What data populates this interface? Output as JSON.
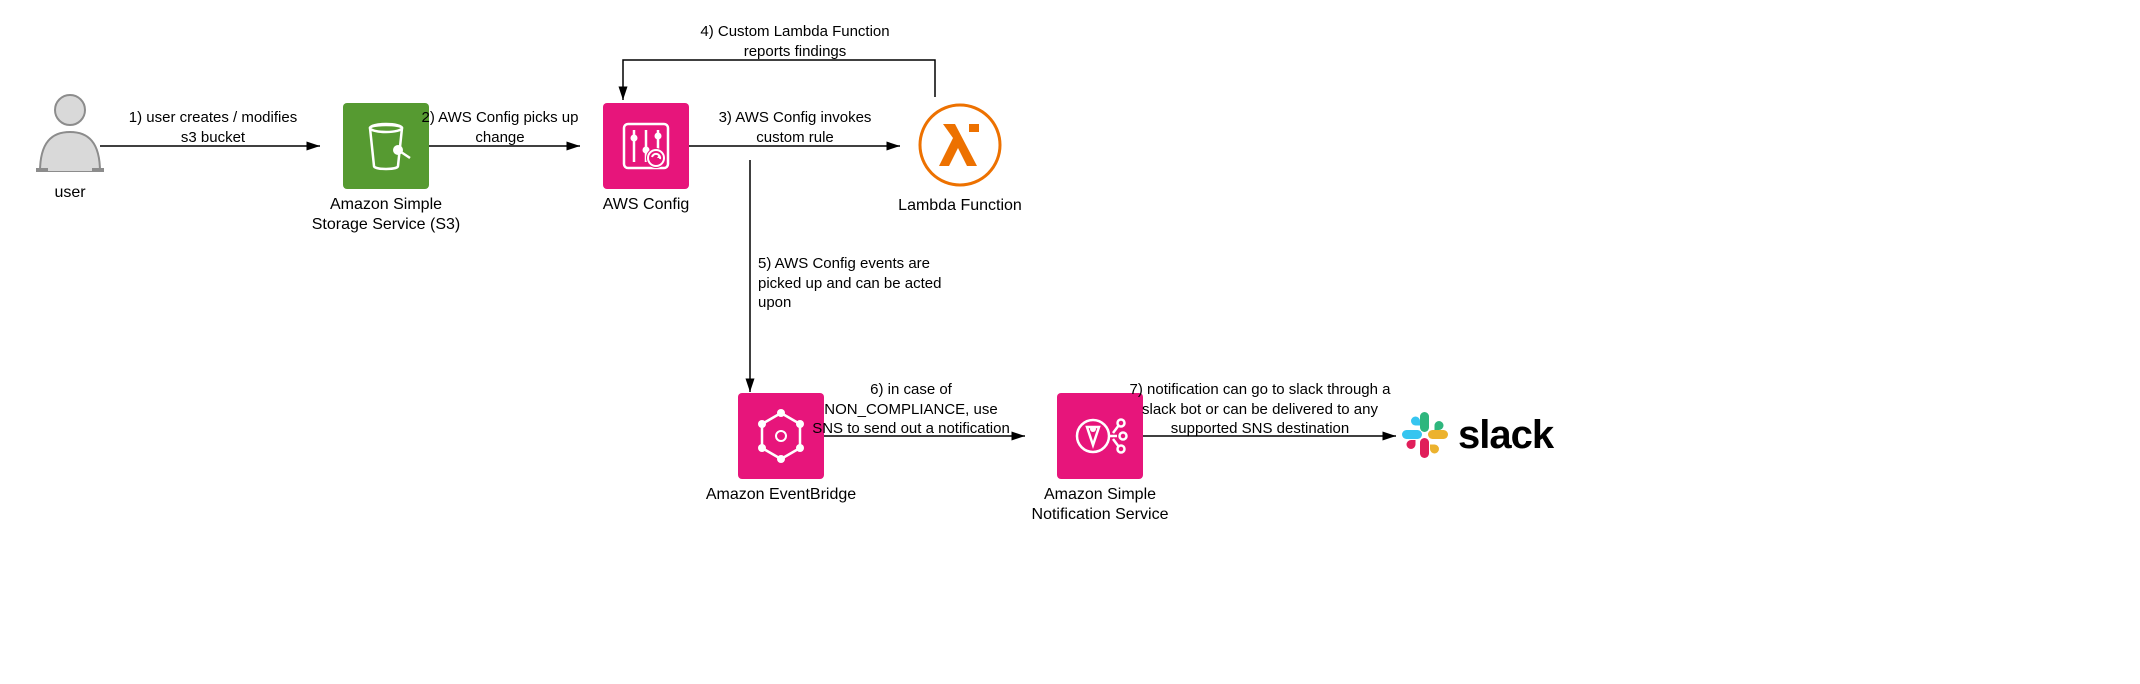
{
  "nodes": {
    "user": {
      "label": "user"
    },
    "s3": {
      "label": "Amazon Simple\nStorage Service (S3)"
    },
    "config": {
      "label": "AWS Config"
    },
    "lambda": {
      "label": "Lambda Function"
    },
    "eventbridge": {
      "label": "Amazon EventBridge"
    },
    "sns": {
      "label": "Amazon Simple\nNotification Service"
    },
    "slack": {
      "label": "slack"
    }
  },
  "edges": {
    "e1": "1) user creates / modifies\ns3 bucket",
    "e2": "2) AWS Config picks up\nchange",
    "e3": "3) AWS Config invokes\ncustom rule",
    "e4": "4) Custom Lambda Function\nreports findings",
    "e5": "5) AWS Config events are\npicked up and can be acted\nupon",
    "e6": "6) in case of\nNON_COMPLIANCE, use\nSNS to send out a notification",
    "e7": "7) notification can go to slack through a\nslack bot or can be delivered to any\nsupported SNS destination"
  },
  "colors": {
    "s3": "#569A31",
    "pink": "#E7157B",
    "lambda": "#ED7100",
    "slack": {
      "green": "#2EB67D",
      "yellow": "#ECB22E",
      "blue": "#36C5F0",
      "red": "#E01E5A"
    }
  }
}
